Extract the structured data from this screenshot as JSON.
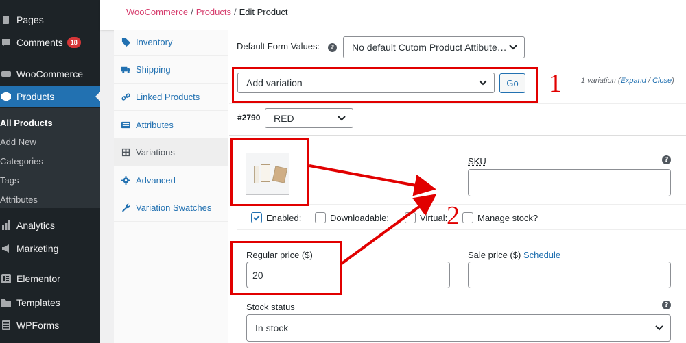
{
  "sidebar": {
    "items": [
      {
        "label": "Pages",
        "icon": "pages-icon"
      },
      {
        "label": "Comments",
        "icon": "comments-icon",
        "badge": "18"
      },
      {
        "label": "WooCommerce",
        "icon": "woocommerce-icon"
      },
      {
        "label": "Products",
        "icon": "products-icon"
      },
      {
        "label": "Analytics",
        "icon": "analytics-icon"
      },
      {
        "label": "Marketing",
        "icon": "marketing-icon"
      },
      {
        "label": "Elementor",
        "icon": "elementor-icon"
      },
      {
        "label": "Templates",
        "icon": "templates-icon"
      },
      {
        "label": "WPForms",
        "icon": "wpforms-icon"
      }
    ],
    "submenu": [
      "All Products",
      "Add New",
      "Categories",
      "Tags",
      "Attributes"
    ]
  },
  "breadcrumb": {
    "items": [
      "WooCommerce",
      "Products"
    ],
    "separator": "/",
    "current": "Edit Product"
  },
  "tabs": [
    "Inventory",
    "Shipping",
    "Linked Products",
    "Attributes",
    "Variations",
    "Advanced",
    "Variation Swatches"
  ],
  "variations": {
    "default_form_label": "Default Form Values:",
    "default_form_help": "?",
    "default_form_value": "No default Cutom Product Attibute…",
    "action_select": "Add variation",
    "go_button": "Go",
    "count_text": "1 variation",
    "expand_link": "Expand",
    "slash": "/",
    "close_link": "Close",
    "open_paren": "(",
    "close_paren": ")",
    "variation_id": "#2790",
    "variation_color": "RED",
    "sku_label": "SKU",
    "sku_help": "?",
    "sku_value": "",
    "enabled_label": "Enabled:",
    "downloadable_label": "Downloadable:",
    "virtual_label": "Virtual:",
    "manage_stock_label": "Manage stock?",
    "regular_price_label": "Regular price ($)",
    "regular_price_value": "20",
    "sale_price_label": "Sale price ($)",
    "schedule_link": "Schedule",
    "sale_price_value": "",
    "stock_status_label": "Stock status",
    "stock_status_help": "?",
    "stock_status_value": "In stock"
  },
  "annotations": {
    "marker_1": "1",
    "marker_2": "2",
    "color": "#e10000"
  },
  "colors": {
    "sidebar_bg": "#1d2327",
    "sidebar_current": "#2271b1",
    "link": "#2271b1",
    "breadcrumb_link": "#d63e6e",
    "badge": "#d63638"
  }
}
